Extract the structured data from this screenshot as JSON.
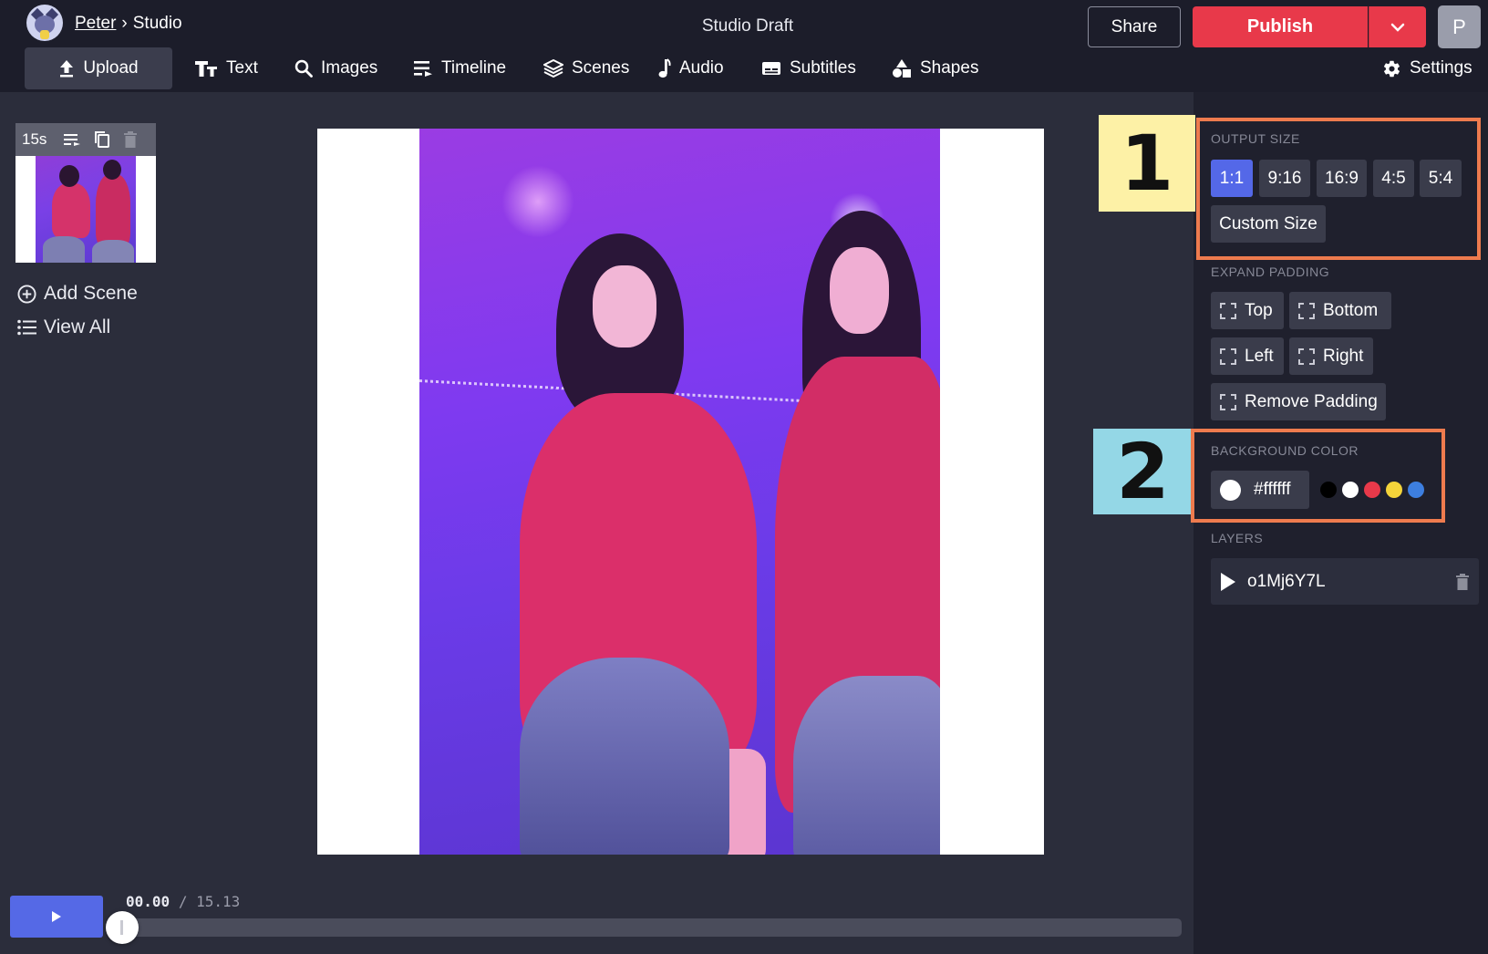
{
  "header": {
    "breadcrumb_user": "Peter",
    "breadcrumb_sep": "›",
    "breadcrumb_page": "Studio",
    "project_title": "Studio Draft",
    "share_label": "Share",
    "publish_label": "Publish",
    "user_initial": "P"
  },
  "toolbar": {
    "upload": "Upload",
    "text": "Text",
    "images": "Images",
    "timeline": "Timeline",
    "scenes": "Scenes",
    "audio": "Audio",
    "subtitles": "Subtitles",
    "shapes": "Shapes",
    "settings": "Settings"
  },
  "scenes": {
    "duration": "15s",
    "add_scene": "Add Scene",
    "view_all": "View All"
  },
  "player": {
    "current_time": "00.00",
    "separator": "/",
    "total_time": "15.13",
    "progress_fraction": 0.0
  },
  "output_size": {
    "label": "OUTPUT SIZE",
    "options": [
      "1:1",
      "9:16",
      "16:9",
      "4:5",
      "5:4"
    ],
    "selected": "1:1",
    "custom": "Custom Size"
  },
  "expand_padding": {
    "label": "EXPAND PADDING",
    "top": "Top",
    "bottom": "Bottom",
    "left": "Left",
    "right": "Right",
    "remove": "Remove Padding"
  },
  "background_color": {
    "label": "BACKGROUND COLOR",
    "value": "#ffffff",
    "presets": [
      "#000000",
      "#ffffff",
      "#e8394a",
      "#f4d43a",
      "#3d7fe0"
    ]
  },
  "layers": {
    "label": "LAYERS",
    "items": [
      {
        "name": "o1Mj6Y7L"
      }
    ]
  },
  "annotations": {
    "one": "1",
    "two": "2",
    "colors": {
      "box": "#ee7b4e",
      "tag_one": "#fdf1a6",
      "tag_two": "#94d7e6"
    }
  }
}
